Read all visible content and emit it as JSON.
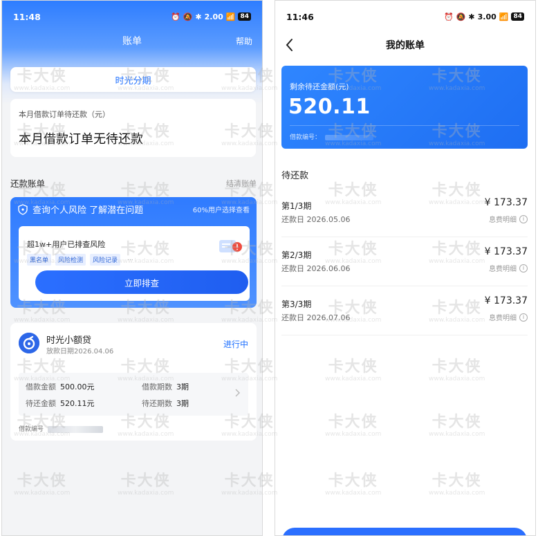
{
  "watermark": {
    "cn": "卡大侠",
    "en": "www.kadaxia.com"
  },
  "left": {
    "status": {
      "time": "11:48",
      "net": "2.00",
      "battery": "84"
    },
    "title": "账单",
    "help": "帮助",
    "tab": "时光分期",
    "month_card": {
      "label": "本月借款订单待还款（元）",
      "value": "本月借款订单无待还款"
    },
    "section": {
      "title": "还款账单",
      "link": "结清账单"
    },
    "risk": {
      "title": "查询个人风险 了解潜在问题",
      "sub": "60%用户选择查看",
      "headline": "超1w+用户已排查风险",
      "tags": [
        "黑名单",
        "风险检测",
        "风险记录",
        "..."
      ],
      "button": "立即排查"
    },
    "loan": {
      "name": "时光小额贷",
      "date": "放款日期2026.04.06",
      "status": "进行中",
      "amount_label": "借款金额",
      "amount_value": "500.00元",
      "term_label": "借款期数",
      "term_value": "3期",
      "repay_label": "待还金额",
      "repay_value": "520.11元",
      "remaining_label": "待还期数",
      "remaining_value": "3期",
      "no_label": "借款编号"
    }
  },
  "right": {
    "status": {
      "time": "11:46",
      "net": "3.00",
      "battery": "84"
    },
    "title": "我的账单",
    "amount_label": "剩余待还金额(元)",
    "amount_value": "520.11",
    "no_label": "借款编号：",
    "pending_title": "待还款",
    "installments": [
      {
        "period": "第1/3期",
        "date": "还款日 2026.05.06",
        "amount": "¥ 173.37",
        "detail": "息费明细"
      },
      {
        "period": "第2/3期",
        "date": "还款日 2026.06.06",
        "amount": "¥ 173.37",
        "detail": "息费明细"
      },
      {
        "period": "第3/3期",
        "date": "还款日 2026.07.06",
        "amount": "¥ 173.37",
        "detail": "息费明细"
      }
    ]
  }
}
